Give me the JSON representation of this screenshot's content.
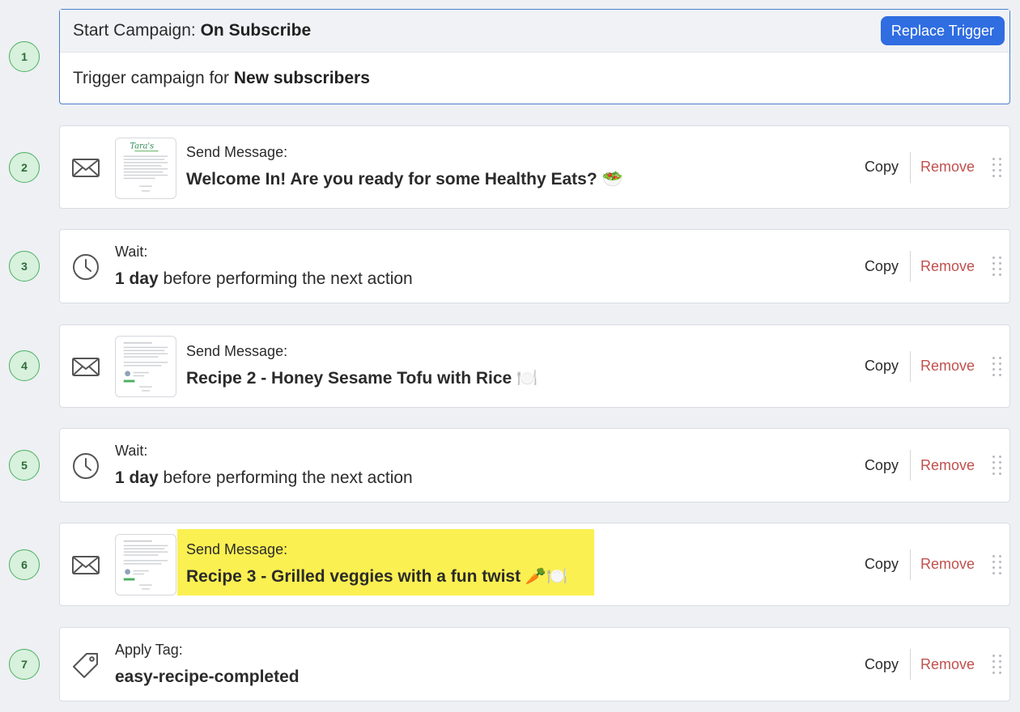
{
  "trigger": {
    "step": "1",
    "title_prefix": "Start Campaign: ",
    "title_bold": "On Subscribe",
    "replace_label": "Replace Trigger",
    "body_prefix": "Trigger campaign for ",
    "body_bold": "New subscribers"
  },
  "actions": {
    "copy_label": "Copy",
    "remove_label": "Remove"
  },
  "steps": [
    {
      "step": "2",
      "type": "send-message",
      "icon": "envelope-icon",
      "label": "Send Message:",
      "value": "Welcome In! Are you ready for some Healthy Eats? 🥗"
    },
    {
      "step": "3",
      "type": "wait",
      "icon": "clock-icon",
      "label": "Wait:",
      "value_bold": "1 day",
      "value_rest": " before performing the next action"
    },
    {
      "step": "4",
      "type": "send-message",
      "icon": "envelope-icon",
      "label": "Send Message:",
      "value": "Recipe 2 - Honey Sesame Tofu with Rice 🍽️"
    },
    {
      "step": "5",
      "type": "wait",
      "icon": "clock-icon",
      "label": "Wait:",
      "value_bold": "1 day",
      "value_rest": " before performing the next action"
    },
    {
      "step": "6",
      "type": "send-message",
      "icon": "envelope-icon",
      "label": "Send Message:",
      "value": "Recipe 3 - Grilled veggies with a fun twist 🥕🍽️",
      "highlighted": true
    },
    {
      "step": "7",
      "type": "apply-tag",
      "icon": "tag-icon",
      "label": "Apply Tag:",
      "value": "easy-recipe-completed"
    }
  ],
  "colors": {
    "accent": "#2f6de1",
    "remove": "#c0504d",
    "step_badge": "#d7f1dc",
    "highlight": "#fbf051"
  }
}
